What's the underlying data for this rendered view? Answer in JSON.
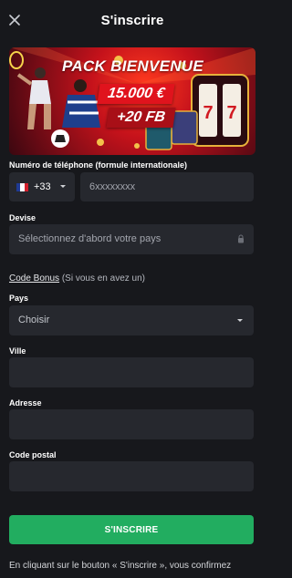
{
  "header": {
    "title": "S'inscrire",
    "close_icon": "close-icon"
  },
  "banner": {
    "line1": "PACK BIENVENUE",
    "amount": "15.000 €",
    "bets": "+20 FB"
  },
  "phone": {
    "label": "Numéro de téléphone (formule internationale)",
    "country_code": "+33",
    "flag": "france-flag-icon",
    "placeholder": "6xxxxxxxx"
  },
  "currency": {
    "label": "Devise",
    "placeholder": "Sélectionnez d'abord votre pays",
    "icon": "lock-icon"
  },
  "bonus": {
    "link": "Code Bonus",
    "note": "(Si vous en avez un)"
  },
  "country": {
    "label": "Pays",
    "value": "Choisir"
  },
  "city": {
    "label": "Ville",
    "value": ""
  },
  "address": {
    "label": "Adresse",
    "value": ""
  },
  "postal": {
    "label": "Code postal",
    "value": ""
  },
  "submit": {
    "label": "S'INSCRIRE"
  },
  "footer": {
    "text": "En cliquant sur le bouton « S'inscrire », vous confirmez"
  },
  "colors": {
    "background": "#17181c",
    "field": "#26282e",
    "accent": "#22ad60",
    "banner_red": "#e0131d"
  }
}
